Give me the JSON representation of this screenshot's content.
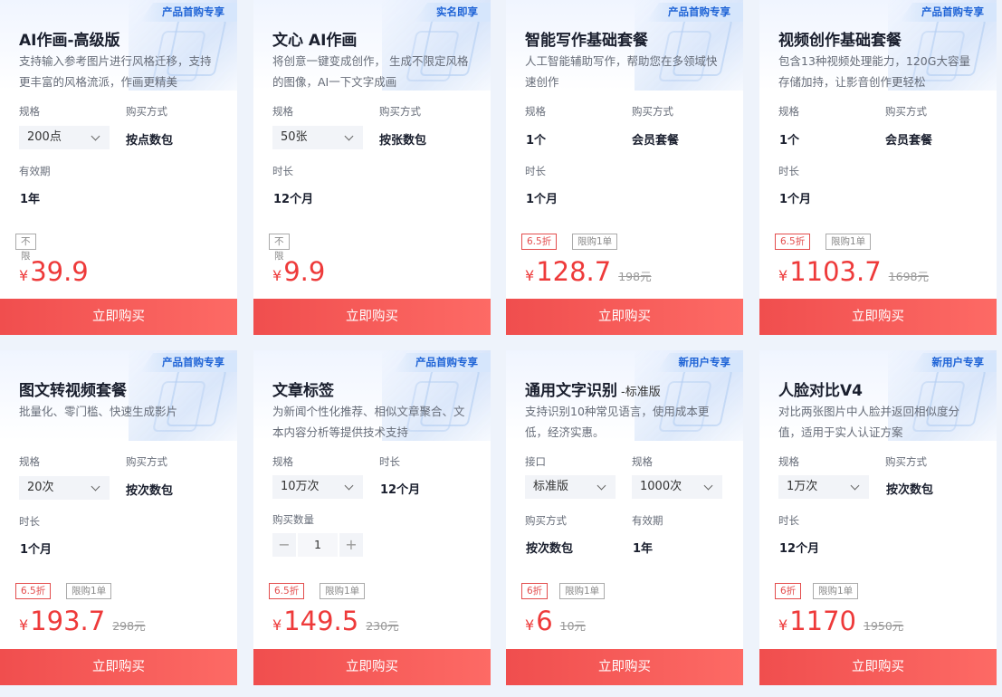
{
  "cards": [
    {
      "tag": "产品首购专享",
      "title": "AI作画-高级版",
      "desc": "支持输入参考图片进行风格迁移，支持更丰富的风格流派，作画更精美",
      "f1_label": "规格",
      "f1_value": "200点",
      "f2_label": "购买方式",
      "f2_value": "按点数包",
      "f3_label": "有效期",
      "f3_value": "1年",
      "badge1": "不限",
      "currency": "¥",
      "price": "39.9",
      "buy": "立即购买"
    },
    {
      "tag": "实名即享",
      "title": "文心 AI作画",
      "desc": "将创意一键变成创作， 生成不限定风格的图像，AI一下文字成画",
      "f1_label": "规格",
      "f1_value": "50张",
      "f2_label": "购买方式",
      "f2_value": "按张数包",
      "f3_label": "时长",
      "f3_value": "12个月",
      "badge1": "不限",
      "currency": "¥",
      "price": "9.9",
      "buy": "立即购买"
    },
    {
      "tag": "产品首购专享",
      "title": "智能写作基础套餐",
      "desc": "人工智能辅助写作，帮助您在多领域快速创作",
      "f1_label": "规格",
      "f1_value": "1个",
      "f2_label": "购买方式",
      "f2_value": "会员套餐",
      "f3_label": "时长",
      "f3_value": "1个月",
      "badge1": "6.5折",
      "badge2": "限购1单",
      "currency": "¥",
      "price": "128.7",
      "orig": "198元",
      "buy": "立即购买"
    },
    {
      "tag": "产品首购专享",
      "title": "视频创作基础套餐",
      "desc": "包含13种视频处理能力，120G大容量存储加持，让影音创作更轻松",
      "f1_label": "规格",
      "f1_value": "1个",
      "f2_label": "购买方式",
      "f2_value": "会员套餐",
      "f3_label": "时长",
      "f3_value": "1个月",
      "badge1": "6.5折",
      "badge2": "限购1单",
      "currency": "¥",
      "price": "1103.7",
      "orig": "1698元",
      "buy": "立即购买"
    },
    {
      "tag": "产品首购专享",
      "title": "图文转视频套餐",
      "desc": "批量化、零门槛、快速生成影片",
      "f1_label": "规格",
      "f1_value": "20次",
      "f2_label": "购买方式",
      "f2_value": "按次数包",
      "f3_label": "时长",
      "f3_value": "1个月",
      "badge1": "6.5折",
      "badge2": "限购1单",
      "currency": "¥",
      "price": "193.7",
      "orig": "298元",
      "buy": "立即购买"
    },
    {
      "tag": "产品首购专享",
      "title": "文章标签",
      "desc": "为新闻个性化推荐、相似文章聚合、文本内容分析等提供技术支持",
      "f1_label": "规格",
      "f1_value": "10万次",
      "f2_label": "时长",
      "f2_value": "12个月",
      "f3_label": "购买数量",
      "qty": "1",
      "badge1": "6.5折",
      "badge2": "限购1单",
      "currency": "¥",
      "price": "149.5",
      "orig": "230元",
      "buy": "立即购买"
    },
    {
      "tag": "新用户专享",
      "title": "通用文字识别",
      "title_sub": "-标准版",
      "desc": "支持识别10种常见语言，使用成本更低，经济实惠。",
      "f1_label": "接口",
      "f1_value": "标准版",
      "f2_label": "规格",
      "f2_value": "1000次",
      "f3_label": "购买方式",
      "f3_value": "按次数包",
      "f4_label": "有效期",
      "f4_value": "1年",
      "badge1": "6折",
      "badge2": "限购1单",
      "currency": "¥",
      "price": "6",
      "orig": "10元",
      "buy": "立即购买"
    },
    {
      "tag": "新用户专享",
      "title": "人脸对比V4",
      "desc": "对比两张图片中人脸并返回相似度分值，适用于实人认证方案",
      "f1_label": "规格",
      "f1_value": "1万次",
      "f2_label": "购买方式",
      "f2_value": "按次数包",
      "f3_label": "时长",
      "f3_value": "12个月",
      "badge1": "6折",
      "badge2": "限购1单",
      "currency": "¥",
      "price": "1170",
      "orig": "1950元",
      "buy": "立即购买"
    }
  ]
}
